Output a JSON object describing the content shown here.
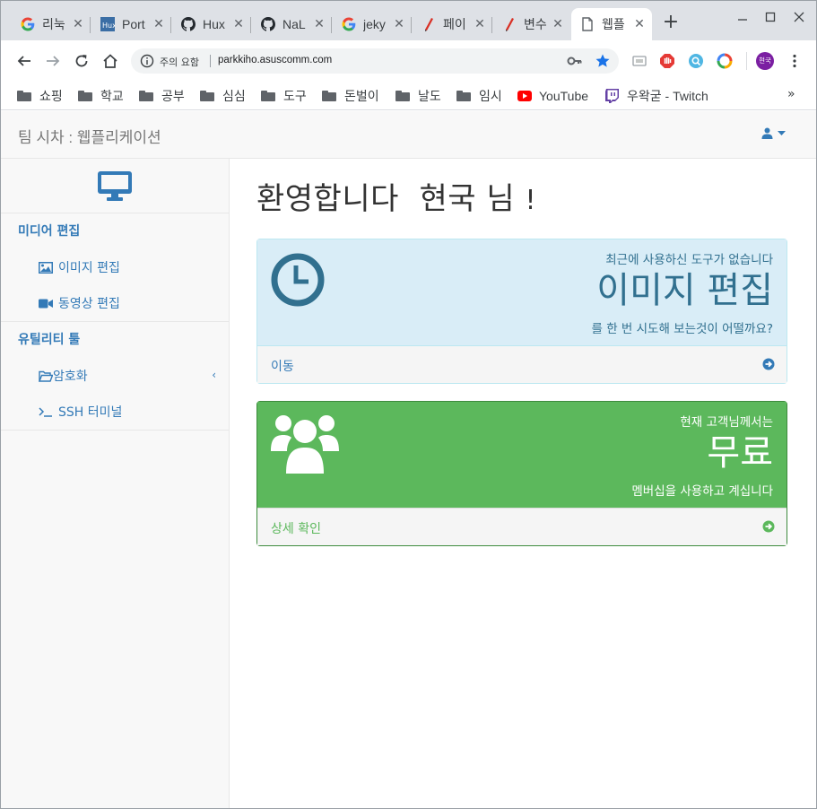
{
  "tabs": [
    {
      "title": "리눅",
      "favicon": "google-icon"
    },
    {
      "title": "Port",
      "favicon": "hux-icon"
    },
    {
      "title": "Hux",
      "favicon": "github-icon"
    },
    {
      "title": "NaL",
      "favicon": "github-icon"
    },
    {
      "title": "jeky",
      "favicon": "google-icon"
    },
    {
      "title": "페이",
      "favicon": "pen-icon"
    },
    {
      "title": "변수",
      "favicon": "pen-icon"
    },
    {
      "title": "웹플",
      "favicon": "page-icon",
      "active": true
    }
  ],
  "toolbar": {
    "security_label": "주의 요함",
    "url": "parkkiho.asuscomm.com",
    "profile_label": "현국"
  },
  "bookmarks": [
    {
      "label": "쇼핑",
      "type": "folder"
    },
    {
      "label": "학교",
      "type": "folder"
    },
    {
      "label": "공부",
      "type": "folder"
    },
    {
      "label": "심심",
      "type": "folder"
    },
    {
      "label": "도구",
      "type": "folder"
    },
    {
      "label": "돈벌이",
      "type": "folder"
    },
    {
      "label": "날도",
      "type": "folder"
    },
    {
      "label": "임시",
      "type": "folder"
    },
    {
      "label": "YouTube",
      "type": "youtube"
    },
    {
      "label": "우왁굳 - Twitch",
      "type": "twitch"
    }
  ],
  "navbar": {
    "brand": "팀 시차 : 웹플리케이션"
  },
  "sidebar": {
    "sections": [
      {
        "title": "미디어 편집",
        "items": [
          {
            "label": "이미지 편집",
            "icon": "image-icon"
          },
          {
            "label": "동영상 편집",
            "icon": "video-camera-icon"
          }
        ]
      },
      {
        "title": "유틸리티 툴",
        "items": [
          {
            "label": "암호화",
            "icon": "folder-open-icon"
          },
          {
            "label": "SSH 터미널",
            "icon": "terminal-icon"
          }
        ]
      }
    ]
  },
  "main": {
    "welcome_text": "환영합니다  현국 님",
    "welcome_bang": "!",
    "recent_panel": {
      "line1": "최근에 사용하신 도구가 없습니다",
      "big": "이미지 편집",
      "line3": "를 한 번 시도해 보는것이 어떨까요?",
      "footer": "이동"
    },
    "membership_panel": {
      "line1": "현재 고객님께서는",
      "big": "무료",
      "line3": "멤버십을 사용하고 계십니다",
      "footer": "상세 확인"
    }
  },
  "colors": {
    "primary": "#337ab7",
    "info_bg": "#d9edf7",
    "info_text": "#31708f",
    "success": "#5cb85c"
  }
}
